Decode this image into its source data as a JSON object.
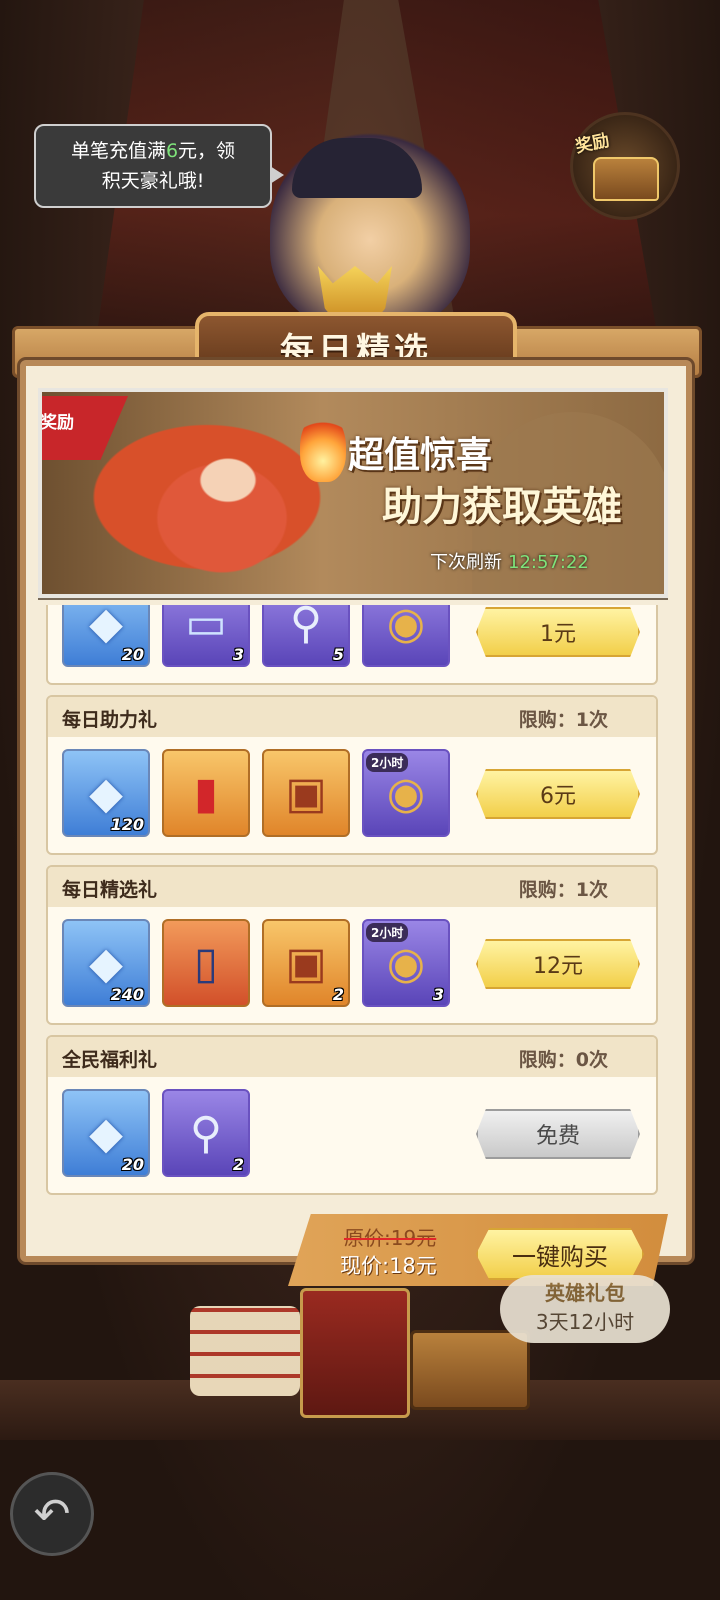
{
  "bubble": {
    "line1_a": "单笔充值满",
    "line1_hl": "6",
    "line1_b": "元，领",
    "line2": "积天豪礼哦!"
  },
  "reward_chest": {
    "label": "奖励"
  },
  "panel": {
    "title": "每日精选"
  },
  "banner": {
    "ribbon": "奖励",
    "title1": "超值惊喜",
    "title2": "助力获取英雄",
    "refresh_label": "下次刷新",
    "refresh_time": "12:57:22"
  },
  "offers": [
    {
      "name": "",
      "limit": "",
      "price": "1元",
      "items": [
        {
          "icon": "diamond-icon",
          "qty": "20",
          "color": "blue"
        },
        {
          "icon": "card-icon",
          "qty": "3",
          "color": "purple"
        },
        {
          "icon": "magnifier-icon",
          "qty": "5",
          "color": "purple"
        },
        {
          "icon": "coin-bag-icon",
          "qty": "",
          "color": "purple"
        }
      ]
    },
    {
      "name": "每日助力礼",
      "limit": "限购：1次",
      "price": "6元",
      "items": [
        {
          "icon": "diamond-icon",
          "qty": "120",
          "color": "blue"
        },
        {
          "icon": "red-card-icon",
          "qty": "",
          "color": "orange"
        },
        {
          "icon": "chest-icon",
          "qty": "",
          "color": "orange"
        },
        {
          "icon": "gold-bag-icon",
          "qty": "",
          "color": "purple",
          "tag": "2小时"
        }
      ]
    },
    {
      "name": "每日精选礼",
      "limit": "限购：1次",
      "price": "12元",
      "items": [
        {
          "icon": "diamond-icon",
          "qty": "240",
          "color": "blue"
        },
        {
          "icon": "hero-card-icon",
          "qty": "",
          "color": "orange"
        },
        {
          "icon": "chest-icon",
          "qty": "2",
          "color": "orange"
        },
        {
          "icon": "gold-bag-icon",
          "qty": "3",
          "color": "purple",
          "tag": "2小时"
        }
      ]
    },
    {
      "name": "全民福利礼",
      "limit": "限购：0次",
      "price": "免费",
      "items": [
        {
          "icon": "diamond-icon",
          "qty": "20",
          "color": "blue"
        },
        {
          "icon": "magnifier-icon",
          "qty": "2",
          "color": "purple"
        }
      ]
    }
  ],
  "bundle": {
    "original_price": "原价:19元",
    "current_price": "现价:18元",
    "buy_all": "一键购买"
  },
  "hero_pack": {
    "title": "英雄礼包",
    "time": "3天12小时"
  },
  "colors": {
    "accent": "#f2cf4a",
    "timer": "#7ee37a",
    "panel": "#f5ecd8",
    "ribbon": "#c8262a"
  }
}
